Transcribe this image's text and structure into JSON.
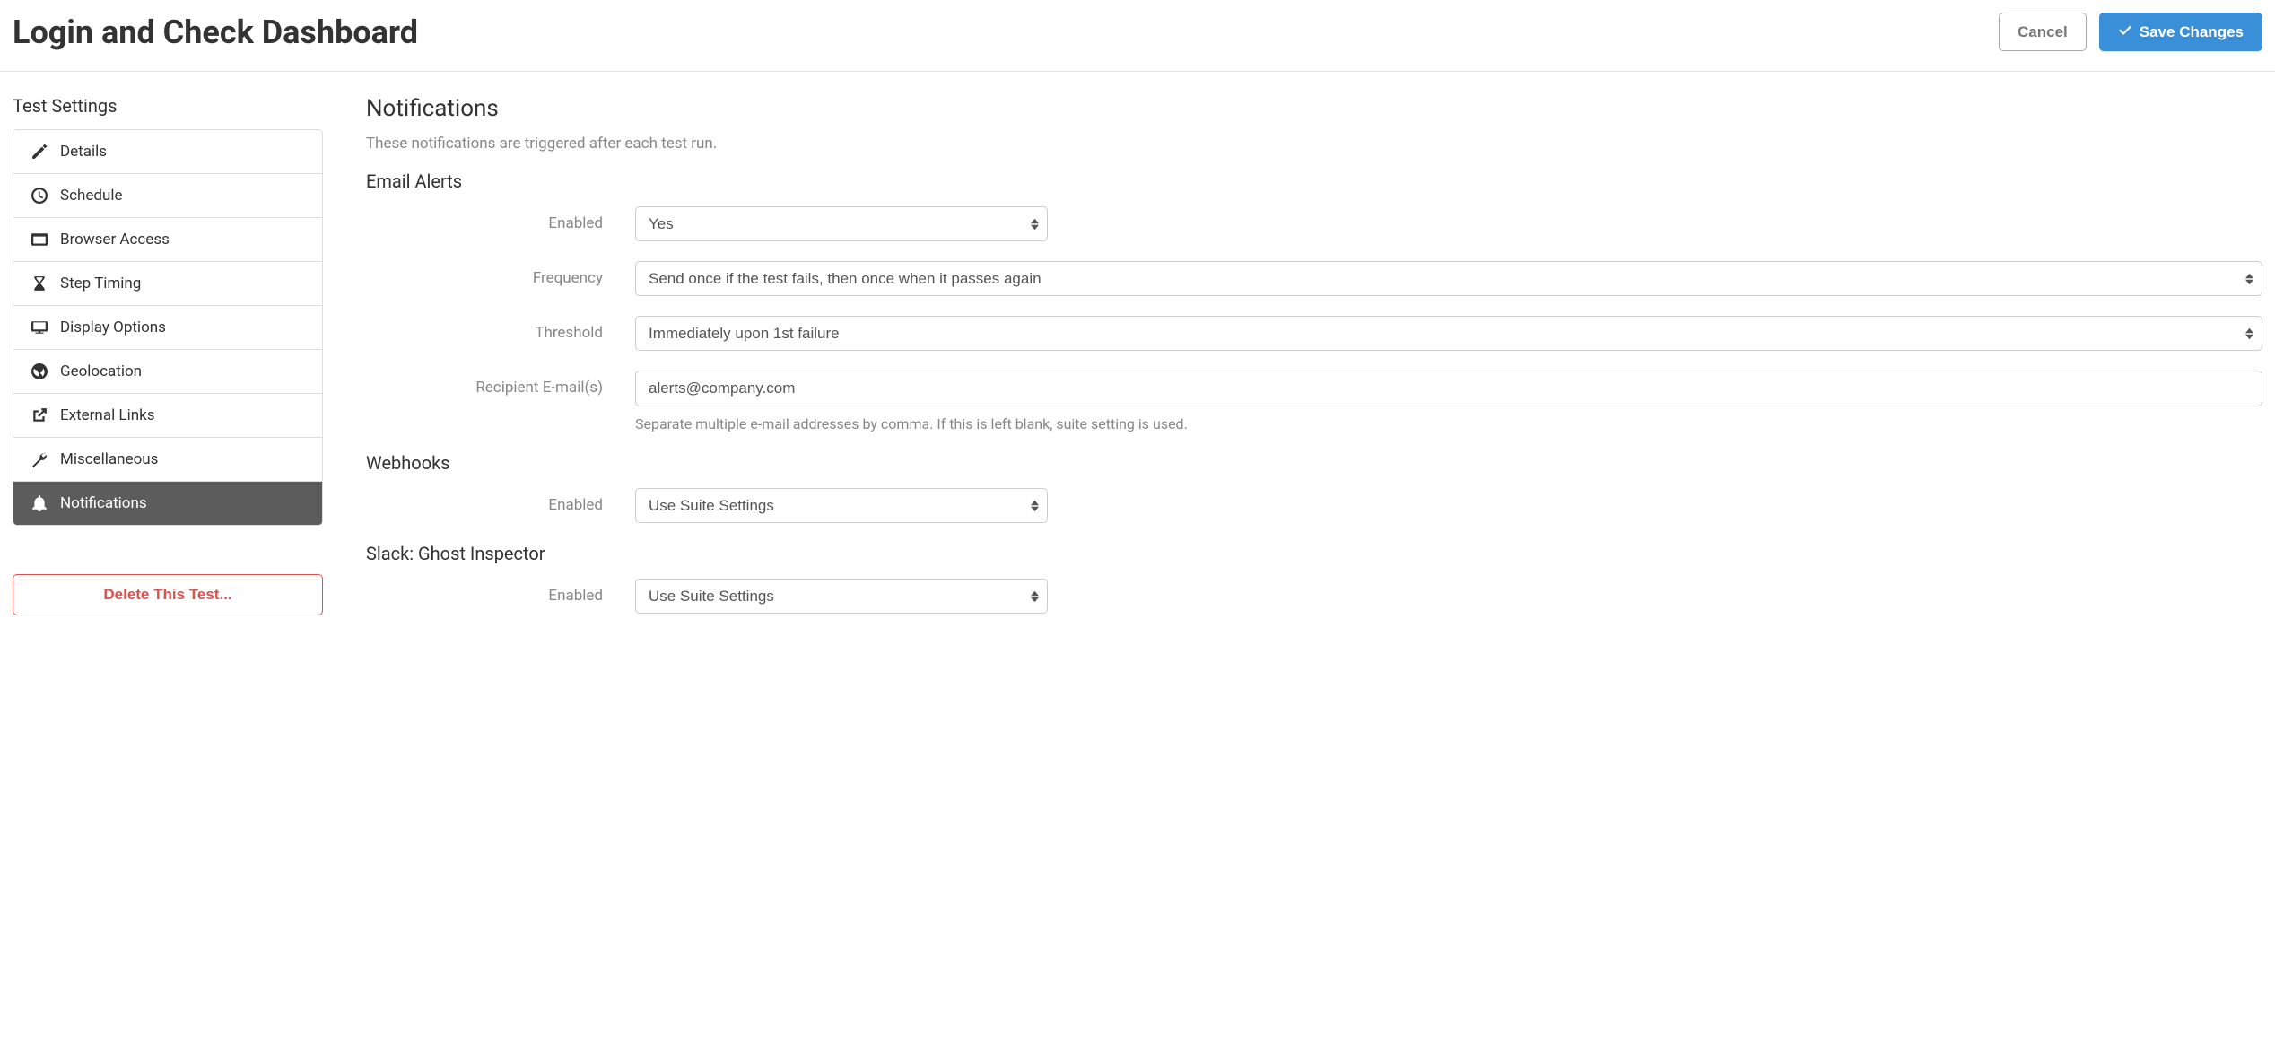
{
  "header": {
    "title": "Login and Check Dashboard",
    "cancel_label": "Cancel",
    "save_label": "Save Changes"
  },
  "sidebar": {
    "title": "Test Settings",
    "items": [
      {
        "label": "Details"
      },
      {
        "label": "Schedule"
      },
      {
        "label": "Browser Access"
      },
      {
        "label": "Step Timing"
      },
      {
        "label": "Display Options"
      },
      {
        "label": "Geolocation"
      },
      {
        "label": "External Links"
      },
      {
        "label": "Miscellaneous"
      },
      {
        "label": "Notifications"
      }
    ],
    "delete_label": "Delete This Test..."
  },
  "main": {
    "heading": "Notifications",
    "description": "These notifications are triggered after each test run.",
    "email": {
      "heading": "Email Alerts",
      "enabled_label": "Enabled",
      "enabled_value": "Yes",
      "frequency_label": "Frequency",
      "frequency_value": "Send once if the test fails, then once when it passes again",
      "threshold_label": "Threshold",
      "threshold_value": "Immediately upon 1st failure",
      "recipients_label": "Recipient E-mail(s)",
      "recipients_value": "alerts@company.com",
      "recipients_help": "Separate multiple e-mail addresses by comma. If this is left blank, suite setting is used."
    },
    "webhooks": {
      "heading": "Webhooks",
      "enabled_label": "Enabled",
      "enabled_value": "Use Suite Settings"
    },
    "slack": {
      "heading": "Slack: Ghost Inspector",
      "enabled_label": "Enabled",
      "enabled_value": "Use Suite Settings"
    }
  }
}
